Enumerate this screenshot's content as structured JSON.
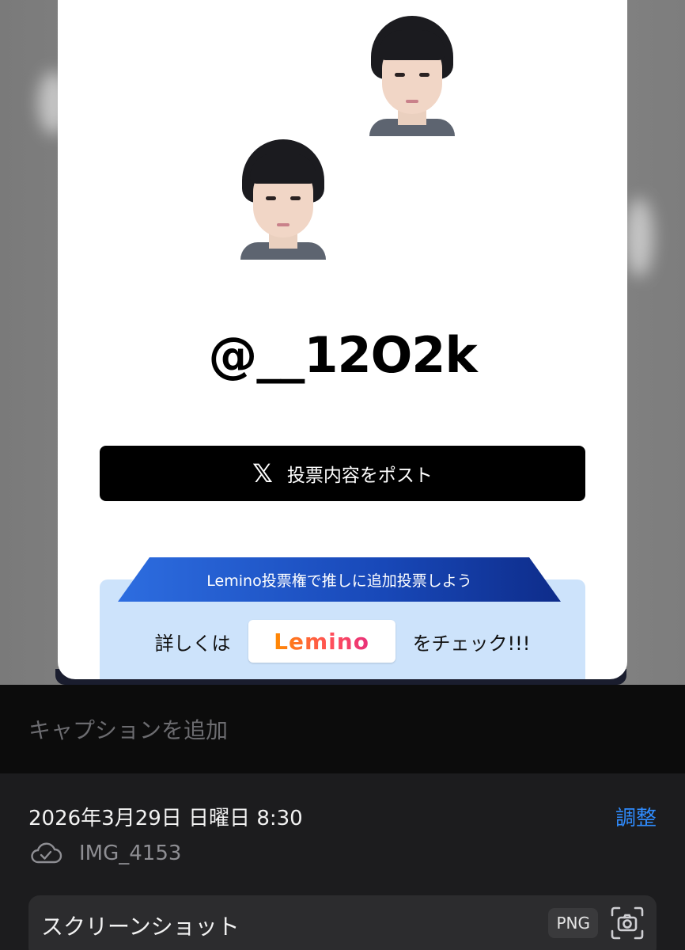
{
  "card": {
    "handle": "@__12O2k",
    "post_button_label": "投票内容をポスト",
    "promo_banner": "Lemino投票権で推しに追加投票しよう",
    "promo_prefix": "詳しくは",
    "promo_logo": "Lemino",
    "promo_suffix": "をチェック!!!"
  },
  "caption": {
    "placeholder": "キャプションを追加"
  },
  "info": {
    "date": "2026年3月29日 日曜日 8:30",
    "adjust_label": "調整",
    "file_name": "IMG_4153",
    "type_label": "スクリーンショット",
    "format_badge": "PNG"
  },
  "icons": {
    "post": "x-logo-icon",
    "cloud": "cloud-check-icon",
    "camera": "screenshot-camera-icon"
  },
  "colors": {
    "accent": "#2f8cff",
    "promo_bg": "#cde3fb",
    "banner": "#1848b8"
  }
}
